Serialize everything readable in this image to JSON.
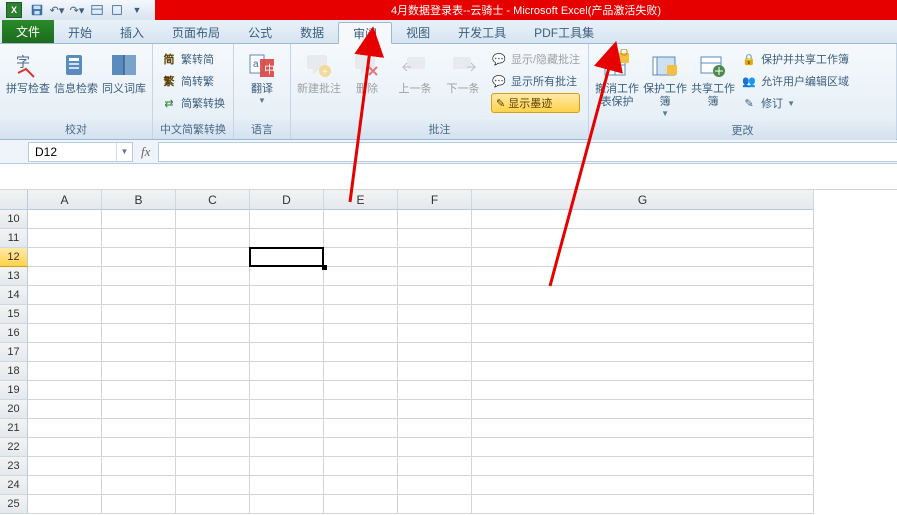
{
  "title": "4月数据登录表--云骑士 - Microsoft Excel(产品激活失败)",
  "qat": {
    "save": "保存",
    "undo": "撤消",
    "redo": "恢复"
  },
  "tabs": {
    "file": "文件",
    "home": "开始",
    "insert": "插入",
    "layout": "页面布局",
    "formulas": "公式",
    "data": "数据",
    "review": "审阅",
    "view": "视图",
    "dev": "开发工具",
    "pdf": "PDF工具集"
  },
  "ribbon": {
    "proofing": {
      "label": "校对",
      "spelling": "拼写检查",
      "research": "信息检索",
      "thesaurus": "同义词库"
    },
    "chinese": {
      "label": "中文简繁转换",
      "to_simp": "繁转简",
      "to_trad": "简转繁",
      "convert": "简繁转换"
    },
    "language": {
      "label": "语言",
      "translate": "翻译"
    },
    "comments": {
      "label": "批注",
      "new": "新建批注",
      "delete": "删除",
      "prev": "上一条",
      "next": "下一条",
      "show_hide": "显示/隐藏批注",
      "show_all": "显示所有批注",
      "show_ink": "显示墨迹"
    },
    "changes": {
      "label": "更改",
      "unprotect_sheet": "撤消工作表保护",
      "protect_wb": "保护工作簿",
      "share_wb": "共享工作簿",
      "protect_share": "保护并共享工作簿",
      "allow_ranges": "允许用户编辑区域",
      "track": "修订"
    }
  },
  "namebox": "D12",
  "columns": [
    "A",
    "B",
    "C",
    "D",
    "E",
    "F",
    "G"
  ],
  "rows": [
    "10",
    "11",
    "12",
    "13",
    "14",
    "15",
    "16",
    "17",
    "18",
    "19",
    "20",
    "21",
    "22",
    "23",
    "24",
    "25"
  ],
  "selected_row_index": 2
}
